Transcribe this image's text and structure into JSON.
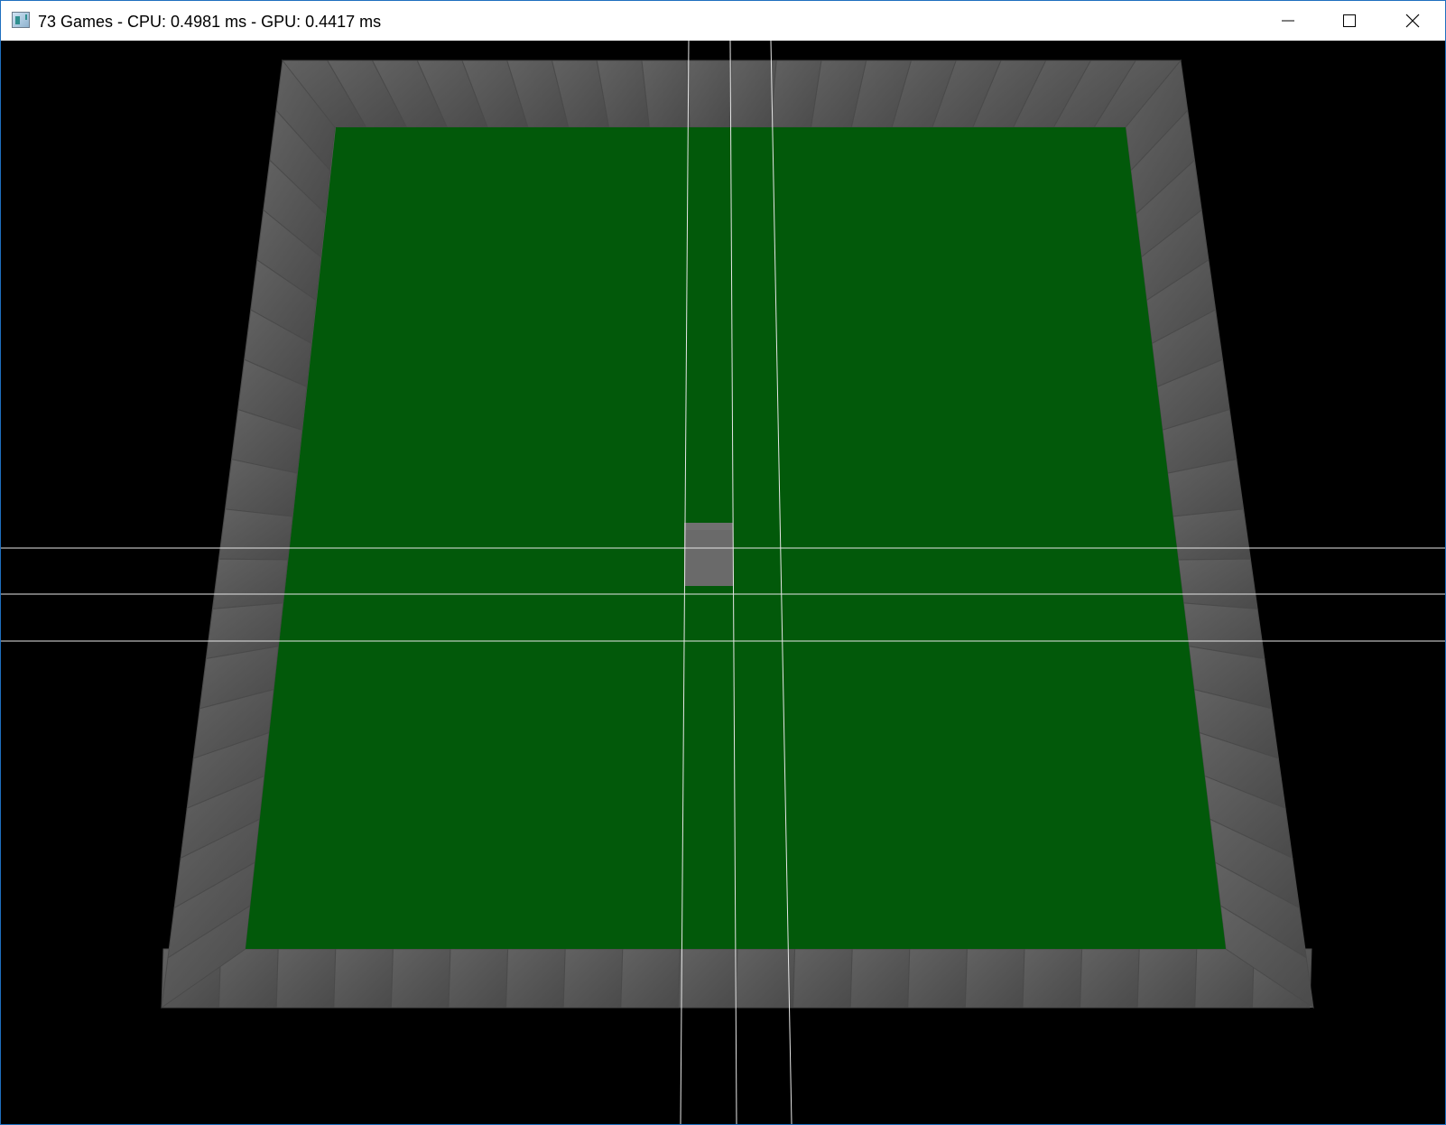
{
  "window": {
    "title": "73 Games - CPU: 0.4981 ms - GPU: 0.4417 ms",
    "icon": "app-window-icon",
    "controls": {
      "minimize_icon": "minimize-icon",
      "maximize_icon": "maximize-icon",
      "close_icon": "close-icon"
    }
  },
  "scene": {
    "background_color": "#000000",
    "floor_color": "#02590a",
    "wall_color": "#626262",
    "wall_shadow_color": "#4a4a4a",
    "guide_line_color": "#e6e6e6",
    "player_block_color": "#6a6a6a",
    "objects": [
      "border-wall-blocks",
      "green-floor",
      "player-block",
      "guide-lines"
    ]
  }
}
